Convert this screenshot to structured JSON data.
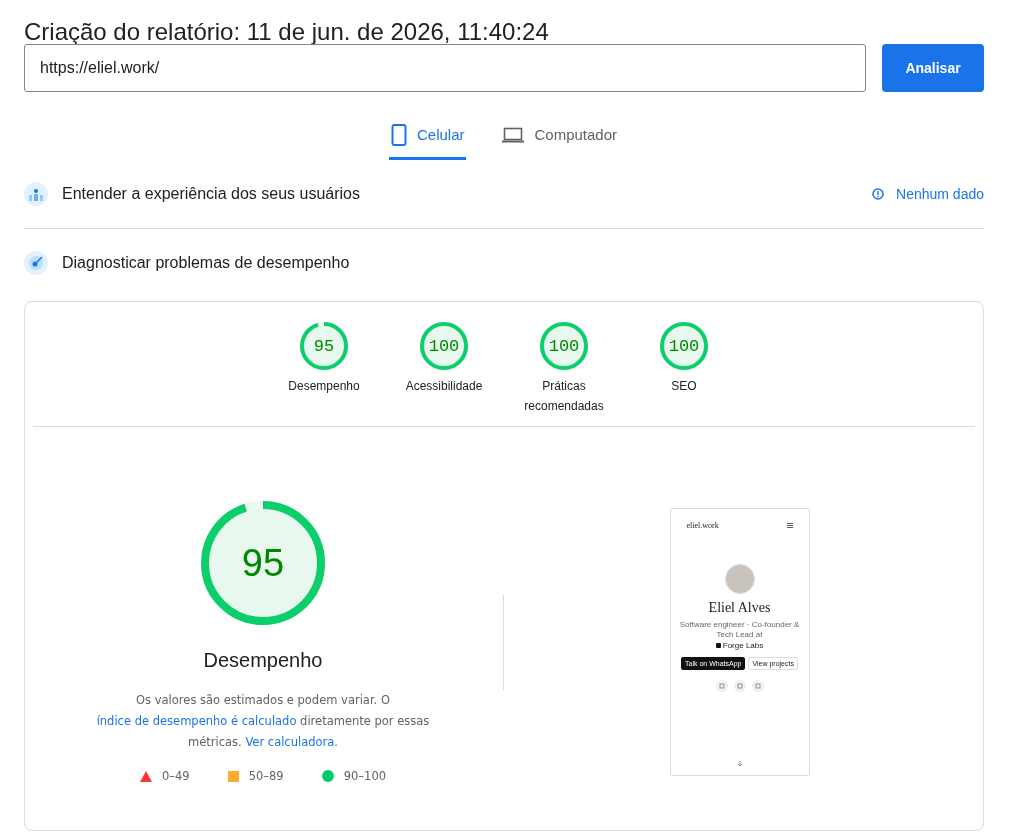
{
  "report_title": "Criação do relatório: 11 de jun. de 2026, 11:40:24",
  "url_field": {
    "value": "https://eliel.work/"
  },
  "analyze_button": "Analisar",
  "device_tabs": [
    {
      "label": "Celular",
      "kind": "mobile",
      "selected": true
    },
    {
      "label": "Computador",
      "kind": "desktop",
      "selected": false
    }
  ],
  "sections": [
    {
      "title": "Entender a experiência dos seus usuários",
      "kind": "field",
      "status": "Nenhum dado"
    },
    {
      "title": "Diagnosticar problemas de desempenho",
      "kind": "lab"
    }
  ],
  "category_gauges": [
    {
      "score": "95",
      "label": "Desempenho",
      "level": 0.95
    },
    {
      "score": "100",
      "label": "Acessibilidade",
      "level": 1
    },
    {
      "score": "100",
      "label": "Práticas recomendadas",
      "level": 1
    },
    {
      "score": "100",
      "label": "SEO",
      "level": 1
    }
  ],
  "performance": {
    "score": "95",
    "level": 0.95,
    "title": "Desempenho",
    "note": [
      {
        "text": "Os valores são estimados e podem variar. O ",
        "link": false
      },
      {
        "text": "índice de desempenho é calculado",
        "link": true
      },
      {
        "text": " diretamente por essas métricas. ",
        "link": false
      },
      {
        "text": "Ver calculadora.",
        "link": true
      }
    ],
    "legend": [
      {
        "kind": "fail",
        "range": "0–49"
      },
      {
        "kind": "average",
        "range": "50–89"
      },
      {
        "kind": "pass",
        "range": "90–100"
      }
    ]
  },
  "page_screenshot": {
    "site_name": "eliel.work",
    "name": "Eliel Alves",
    "tagline": "Software engineer · Co-founder & Tech Lead at",
    "company": "Forge Labs",
    "buttons": [
      "Talk on WhatsApp",
      "View projects"
    ]
  }
}
